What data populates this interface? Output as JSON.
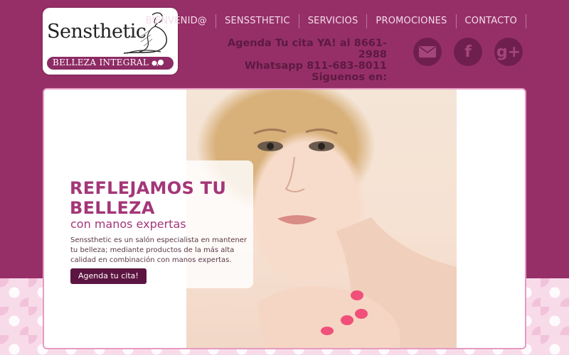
{
  "logo": {
    "name": "Sensthetic",
    "tagline": "BELLEZA INTEGRAL"
  },
  "nav": {
    "items": [
      {
        "label": "BIENVENID@"
      },
      {
        "label": "SENSSTHETIC"
      },
      {
        "label": "SERVICIOS"
      },
      {
        "label": "PROMOCIONES"
      },
      {
        "label": "CONTACTO"
      }
    ]
  },
  "contact": {
    "line1": "Agenda Tu cita YA! al 8661-2988",
    "line2": "Whatsapp 811-683-8011",
    "line3": "Siguenos en:"
  },
  "social": {
    "email_icon": "envelope-icon",
    "facebook_label": "f",
    "googleplus_label": "g+"
  },
  "hero": {
    "title": "REFLEJAMOS TU BELLEZA",
    "subtitle": "con manos expertas",
    "description": "Senssthetic es un salón especialista en mantener tu belleza; mediante productos de la más alta calidad en combinación con manos expertas.",
    "button_label": "Agenda tu cita!"
  },
  "colors": {
    "background": "#962f68",
    "accent": "#a43678",
    "button": "#5c1540",
    "contact_text": "#5d1a41"
  }
}
